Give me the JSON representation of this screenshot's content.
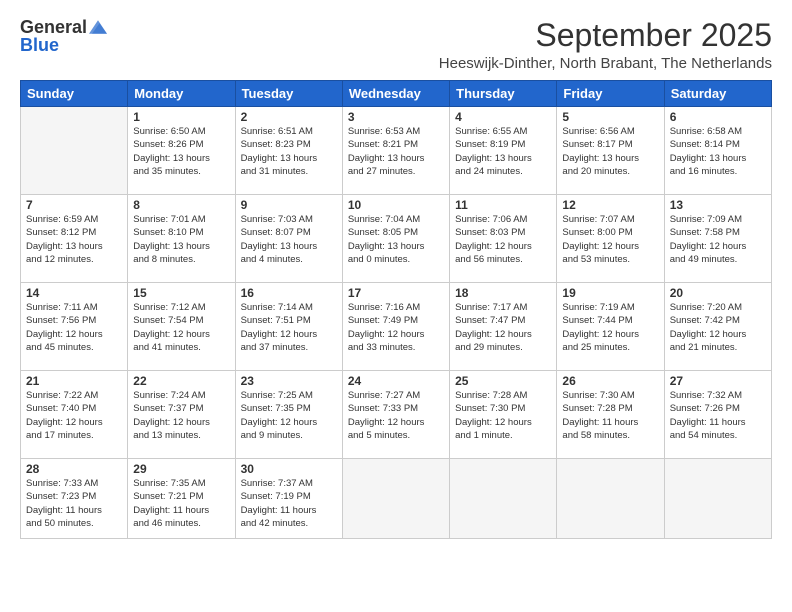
{
  "logo": {
    "general": "General",
    "blue": "Blue"
  },
  "title": "September 2025",
  "location": "Heeswijk-Dinther, North Brabant, The Netherlands",
  "headers": [
    "Sunday",
    "Monday",
    "Tuesday",
    "Wednesday",
    "Thursday",
    "Friday",
    "Saturday"
  ],
  "weeks": [
    [
      {
        "num": "",
        "info": ""
      },
      {
        "num": "1",
        "info": "Sunrise: 6:50 AM\nSunset: 8:26 PM\nDaylight: 13 hours\nand 35 minutes."
      },
      {
        "num": "2",
        "info": "Sunrise: 6:51 AM\nSunset: 8:23 PM\nDaylight: 13 hours\nand 31 minutes."
      },
      {
        "num": "3",
        "info": "Sunrise: 6:53 AM\nSunset: 8:21 PM\nDaylight: 13 hours\nand 27 minutes."
      },
      {
        "num": "4",
        "info": "Sunrise: 6:55 AM\nSunset: 8:19 PM\nDaylight: 13 hours\nand 24 minutes."
      },
      {
        "num": "5",
        "info": "Sunrise: 6:56 AM\nSunset: 8:17 PM\nDaylight: 13 hours\nand 20 minutes."
      },
      {
        "num": "6",
        "info": "Sunrise: 6:58 AM\nSunset: 8:14 PM\nDaylight: 13 hours\nand 16 minutes."
      }
    ],
    [
      {
        "num": "7",
        "info": "Sunrise: 6:59 AM\nSunset: 8:12 PM\nDaylight: 13 hours\nand 12 minutes."
      },
      {
        "num": "8",
        "info": "Sunrise: 7:01 AM\nSunset: 8:10 PM\nDaylight: 13 hours\nand 8 minutes."
      },
      {
        "num": "9",
        "info": "Sunrise: 7:03 AM\nSunset: 8:07 PM\nDaylight: 13 hours\nand 4 minutes."
      },
      {
        "num": "10",
        "info": "Sunrise: 7:04 AM\nSunset: 8:05 PM\nDaylight: 13 hours\nand 0 minutes."
      },
      {
        "num": "11",
        "info": "Sunrise: 7:06 AM\nSunset: 8:03 PM\nDaylight: 12 hours\nand 56 minutes."
      },
      {
        "num": "12",
        "info": "Sunrise: 7:07 AM\nSunset: 8:00 PM\nDaylight: 12 hours\nand 53 minutes."
      },
      {
        "num": "13",
        "info": "Sunrise: 7:09 AM\nSunset: 7:58 PM\nDaylight: 12 hours\nand 49 minutes."
      }
    ],
    [
      {
        "num": "14",
        "info": "Sunrise: 7:11 AM\nSunset: 7:56 PM\nDaylight: 12 hours\nand 45 minutes."
      },
      {
        "num": "15",
        "info": "Sunrise: 7:12 AM\nSunset: 7:54 PM\nDaylight: 12 hours\nand 41 minutes."
      },
      {
        "num": "16",
        "info": "Sunrise: 7:14 AM\nSunset: 7:51 PM\nDaylight: 12 hours\nand 37 minutes."
      },
      {
        "num": "17",
        "info": "Sunrise: 7:16 AM\nSunset: 7:49 PM\nDaylight: 12 hours\nand 33 minutes."
      },
      {
        "num": "18",
        "info": "Sunrise: 7:17 AM\nSunset: 7:47 PM\nDaylight: 12 hours\nand 29 minutes."
      },
      {
        "num": "19",
        "info": "Sunrise: 7:19 AM\nSunset: 7:44 PM\nDaylight: 12 hours\nand 25 minutes."
      },
      {
        "num": "20",
        "info": "Sunrise: 7:20 AM\nSunset: 7:42 PM\nDaylight: 12 hours\nand 21 minutes."
      }
    ],
    [
      {
        "num": "21",
        "info": "Sunrise: 7:22 AM\nSunset: 7:40 PM\nDaylight: 12 hours\nand 17 minutes."
      },
      {
        "num": "22",
        "info": "Sunrise: 7:24 AM\nSunset: 7:37 PM\nDaylight: 12 hours\nand 13 minutes."
      },
      {
        "num": "23",
        "info": "Sunrise: 7:25 AM\nSunset: 7:35 PM\nDaylight: 12 hours\nand 9 minutes."
      },
      {
        "num": "24",
        "info": "Sunrise: 7:27 AM\nSunset: 7:33 PM\nDaylight: 12 hours\nand 5 minutes."
      },
      {
        "num": "25",
        "info": "Sunrise: 7:28 AM\nSunset: 7:30 PM\nDaylight: 12 hours\nand 1 minute."
      },
      {
        "num": "26",
        "info": "Sunrise: 7:30 AM\nSunset: 7:28 PM\nDaylight: 11 hours\nand 58 minutes."
      },
      {
        "num": "27",
        "info": "Sunrise: 7:32 AM\nSunset: 7:26 PM\nDaylight: 11 hours\nand 54 minutes."
      }
    ],
    [
      {
        "num": "28",
        "info": "Sunrise: 7:33 AM\nSunset: 7:23 PM\nDaylight: 11 hours\nand 50 minutes."
      },
      {
        "num": "29",
        "info": "Sunrise: 7:35 AM\nSunset: 7:21 PM\nDaylight: 11 hours\nand 46 minutes."
      },
      {
        "num": "30",
        "info": "Sunrise: 7:37 AM\nSunset: 7:19 PM\nDaylight: 11 hours\nand 42 minutes."
      },
      {
        "num": "",
        "info": ""
      },
      {
        "num": "",
        "info": ""
      },
      {
        "num": "",
        "info": ""
      },
      {
        "num": "",
        "info": ""
      }
    ]
  ]
}
